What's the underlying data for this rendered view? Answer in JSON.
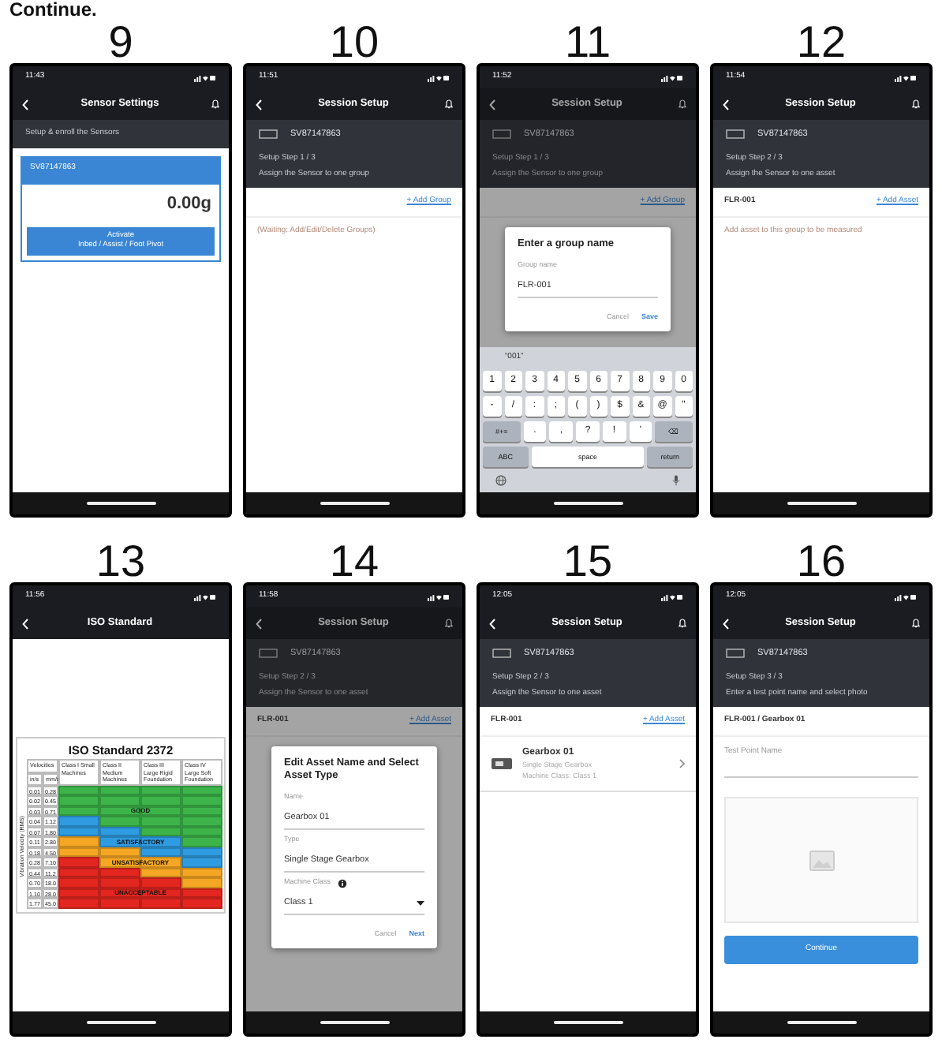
{
  "heading": "Continue.",
  "steps": [
    {
      "number": "9",
      "time": "11:43",
      "title": "Sensor Settings",
      "bell": true,
      "dimmed": false,
      "header": {
        "lines": [
          "Setup & enroll the Sensors"
        ]
      },
      "body": [
        {
          "kind": "sensor_card",
          "name": "SV87147863",
          "value": "0.00g",
          "button_lines": [
            "Activate",
            "Inbed / Assist / Foot Pivot"
          ]
        }
      ]
    },
    {
      "number": "10",
      "time": "11:51",
      "title": "Session Setup",
      "bell": true,
      "dimmed": false,
      "header": {
        "sensor": "SV87147863",
        "lines": [
          "Setup Step 1 / 3",
          "Assign the Sensor to one group"
        ]
      },
      "body": [
        {
          "kind": "link_row",
          "link": "+ Add Group"
        },
        {
          "kind": "hint",
          "text": "(Waiting: Add/Edit/Delete Groups)"
        }
      ]
    },
    {
      "number": "11",
      "time": "11:52",
      "title": "Session Setup",
      "bell": true,
      "dimmed": true,
      "header": {
        "sensor": "SV87147863",
        "lines": [
          "Setup Step 1 / 3",
          "Assign the Sensor to one group"
        ]
      },
      "body": [
        {
          "kind": "link_row",
          "link": "+ Add Group"
        }
      ],
      "dialog": {
        "title": "Enter a group name",
        "fields": [
          {
            "kind": "text",
            "label": "Group name",
            "value": "FLR-001"
          }
        ],
        "actions": [
          {
            "label": "Cancel",
            "primary": false
          },
          {
            "label": "Save",
            "primary": true
          }
        ]
      },
      "keyboard": {
        "suggestion": "“001”",
        "rows": [
          {
            "keys": [
              "1",
              "2",
              "3",
              "4",
              "5",
              "6",
              "7",
              "8",
              "9",
              "0"
            ]
          },
          {
            "keys": [
              "-",
              "/",
              ":",
              ";",
              "(",
              ")",
              "$",
              "&",
              "@",
              "\""
            ]
          },
          {
            "keys": [
              "#+=",
              ".",
              ",",
              "?",
              "!",
              "'",
              "⌫"
            ]
          },
          {
            "keys": [
              "ABC",
              "space",
              "return"
            ]
          }
        ]
      }
    },
    {
      "number": "12",
      "time": "11:54",
      "title": "Session Setup",
      "bell": true,
      "dimmed": false,
      "header": {
        "sensor": "SV87147863",
        "lines": [
          "Setup Step 2 / 3",
          "Assign the Sensor to one asset"
        ]
      },
      "body": [
        {
          "kind": "link_row",
          "label": "FLR-001",
          "link": "+ Add Asset"
        },
        {
          "kind": "hint",
          "text": "Add asset to this group to be measured"
        }
      ]
    },
    {
      "number": "13",
      "time": "11:56",
      "title": "ISO Standard",
      "bell": false,
      "dimmed": false,
      "body": [
        {
          "kind": "iso_table",
          "title": "ISO Standard 2372",
          "side_label": "Vibration Velocity (RMS)",
          "velocity_label": "Velocities",
          "units": [
            "in/s",
            "mm/s"
          ],
          "classes": [
            "Class I Small Machines",
            "Class II Medium Machines",
            "Class III Large Rigid Foundation",
            "Class IV Large Soft Foundation"
          ],
          "rows": [
            {
              "in_s": "0.01",
              "mm_s": "0.28",
              "cells": [
                {
                  "color": "#3cb44a"
                },
                {
                  "color": "#3cb44a"
                },
                {
                  "color": "#3cb44a"
                },
                {
                  "color": "#3cb44a"
                }
              ]
            },
            {
              "in_s": "0.02",
              "mm_s": "0.45",
              "cells": [
                {
                  "color": "#3cb44a"
                },
                {
                  "color": "#3cb44a"
                },
                {
                  "color": "#3cb44a"
                },
                {
                  "color": "#3cb44a"
                }
              ]
            },
            {
              "in_s": "0.03",
              "mm_s": "0.71",
              "cells": [
                {
                  "color": "#3cb44a"
                },
                {
                  "color": "#3cb44a",
                  "label": "GOOD"
                },
                {
                  "color": "#3cb44a"
                },
                {
                  "color": "#3cb44a"
                }
              ]
            },
            {
              "in_s": "0.04",
              "mm_s": "1.12",
              "cells": [
                {
                  "color": "#2f9be0"
                },
                {
                  "color": "#3cb44a"
                },
                {
                  "color": "#3cb44a"
                },
                {
                  "color": "#3cb44a"
                }
              ]
            },
            {
              "in_s": "0.07",
              "mm_s": "1.80",
              "cells": [
                {
                  "color": "#2f9be0"
                },
                {
                  "color": "#2f9be0"
                },
                {
                  "color": "#3cb44a"
                },
                {
                  "color": "#3cb44a"
                }
              ]
            },
            {
              "in_s": "0.11",
              "mm_s": "2.80",
              "cells": [
                {
                  "color": "#f5a623"
                },
                {
                  "color": "#2f9be0",
                  "label": "SATISFACTORY"
                },
                {
                  "color": "#2f9be0"
                },
                {
                  "color": "#3cb44a"
                }
              ]
            },
            {
              "in_s": "0.18",
              "mm_s": "4.50",
              "cells": [
                {
                  "color": "#f5a623"
                },
                {
                  "color": "#f5a623"
                },
                {
                  "color": "#2f9be0"
                },
                {
                  "color": "#2f9be0"
                }
              ]
            },
            {
              "in_s": "0.28",
              "mm_s": "7.10",
              "cells": [
                {
                  "color": "#e3261f"
                },
                {
                  "color": "#f5a623",
                  "label": "UNSATISFACTORY"
                },
                {
                  "color": "#f5a623"
                },
                {
                  "color": "#2f9be0"
                }
              ]
            },
            {
              "in_s": "0.44",
              "mm_s": "11.2",
              "cells": [
                {
                  "color": "#e3261f"
                },
                {
                  "color": "#e3261f"
                },
                {
                  "color": "#f5a623"
                },
                {
                  "color": "#f5a623"
                }
              ]
            },
            {
              "in_s": "0.70",
              "mm_s": "18.0",
              "cells": [
                {
                  "color": "#e3261f"
                },
                {
                  "color": "#e3261f"
                },
                {
                  "color": "#e3261f"
                },
                {
                  "color": "#f5a623"
                }
              ]
            },
            {
              "in_s": "1.10",
              "mm_s": "28.0",
              "cells": [
                {
                  "color": "#e3261f"
                },
                {
                  "color": "#e3261f",
                  "label": "UNACCEPTABLE"
                },
                {
                  "color": "#e3261f"
                },
                {
                  "color": "#e3261f"
                }
              ]
            },
            {
              "in_s": "1.77",
              "mm_s": "45.0",
              "cells": [
                {
                  "color": "#e3261f"
                },
                {
                  "color": "#e3261f"
                },
                {
                  "color": "#e3261f"
                },
                {
                  "color": "#e3261f"
                }
              ]
            }
          ]
        }
      ]
    },
    {
      "number": "14",
      "time": "11:58",
      "title": "Session Setup",
      "bell": true,
      "dimmed": true,
      "header": {
        "sensor": "SV87147863",
        "lines": [
          "Setup Step 2 / 3",
          "Assign the Sensor to one asset"
        ]
      },
      "body": [
        {
          "kind": "link_row",
          "label": "FLR-001",
          "link": "+ Add Asset"
        }
      ],
      "dialog": {
        "title": "Edit Asset Name and Select Asset Type",
        "fields": [
          {
            "kind": "text",
            "label": "Name",
            "value": "Gearbox 01"
          },
          {
            "kind": "text",
            "label": "Type",
            "value": "Single Stage Gearbox"
          },
          {
            "kind": "select",
            "label": "Machine Class",
            "info": true,
            "value": "Class 1"
          }
        ],
        "actions": [
          {
            "label": "Cancel",
            "primary": false
          },
          {
            "label": "Next",
            "primary": true
          }
        ]
      }
    },
    {
      "number": "15",
      "time": "12:05",
      "title": "Session Setup",
      "bell": true,
      "dimmed": false,
      "header": {
        "sensor": "SV87147863",
        "lines": [
          "Setup Step 2 / 3",
          "Assign the Sensor to one asset"
        ]
      },
      "body": [
        {
          "kind": "link_row",
          "label": "FLR-001",
          "link": "+ Add Asset"
        },
        {
          "kind": "asset_row",
          "name": "Gearbox 01",
          "lines": [
            "Single Stage Gearbox",
            "Machine Class: Class 1"
          ]
        }
      ]
    },
    {
      "number": "16",
      "time": "12:05",
      "title": "Session Setup",
      "bell": true,
      "dimmed": false,
      "header": {
        "sensor": "SV87147863",
        "lines": [
          "Setup Step 3 / 3",
          "Enter a test point name and select photo"
        ]
      },
      "body": [
        {
          "kind": "link_row",
          "label": "FLR-001 / Gearbox 01"
        },
        {
          "kind": "field",
          "label": "Test Point Name"
        },
        {
          "kind": "photo"
        },
        {
          "kind": "primary_button",
          "text": "Continue"
        }
      ]
    }
  ]
}
